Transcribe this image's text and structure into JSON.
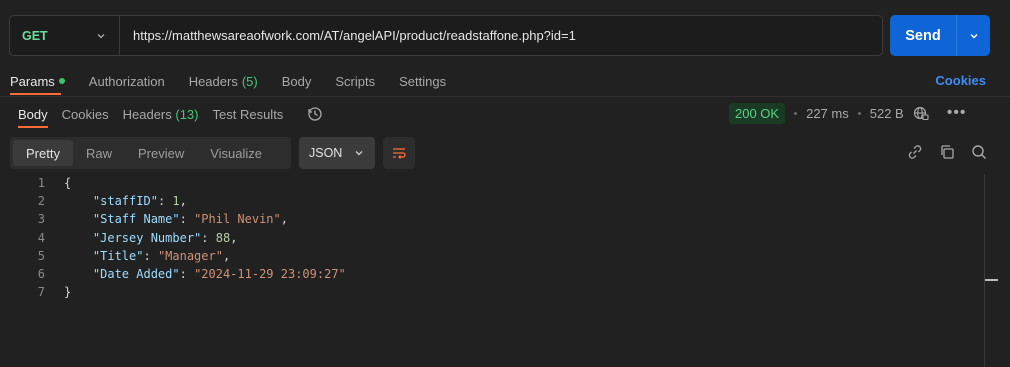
{
  "request": {
    "method": "GET",
    "url": "https://matthewsareaofwork.com/AT/angelAPI/product/readstaffone.php?id=1",
    "send_label": "Send"
  },
  "request_tabs": [
    {
      "label": "Params",
      "active": true,
      "has_dot": true
    },
    {
      "label": "Authorization"
    },
    {
      "label": "Headers",
      "count": "(5)"
    },
    {
      "label": "Body"
    },
    {
      "label": "Scripts"
    },
    {
      "label": "Settings"
    }
  ],
  "cookies_link": "Cookies",
  "response_tabs": [
    {
      "label": "Body",
      "active": true
    },
    {
      "label": "Cookies"
    },
    {
      "label": "Headers",
      "count": "(13)"
    },
    {
      "label": "Test Results"
    }
  ],
  "status": {
    "code": "200 OK",
    "time": "227 ms",
    "size": "522 B"
  },
  "view_tabs": [
    "Pretty",
    "Raw",
    "Preview",
    "Visualize"
  ],
  "format": "JSON",
  "code": {
    "line_numbers": [
      "1",
      "2",
      "3",
      "4",
      "5",
      "6",
      "7"
    ],
    "open_brace": "{",
    "close_brace": "}",
    "fields": [
      {
        "key": "\"staffID\"",
        "value": "1",
        "type": "number",
        "comma": ","
      },
      {
        "key": "\"Staff Name\"",
        "value": "\"Phil Nevin\"",
        "type": "string",
        "comma": ","
      },
      {
        "key": "\"Jersey Number\"",
        "value": "88",
        "type": "number",
        "comma": ","
      },
      {
        "key": "\"Title\"",
        "value": "\"Manager\"",
        "type": "string",
        "comma": ","
      },
      {
        "key": "\"Date Added\"",
        "value": "\"2024-11-29 23:09:27\"",
        "type": "string",
        "comma": ""
      }
    ]
  },
  "colors": {
    "accent": "#ff6c37",
    "send": "#0f65d6",
    "status_ok": "#56d186",
    "get_method": "#6bdd9a"
  }
}
